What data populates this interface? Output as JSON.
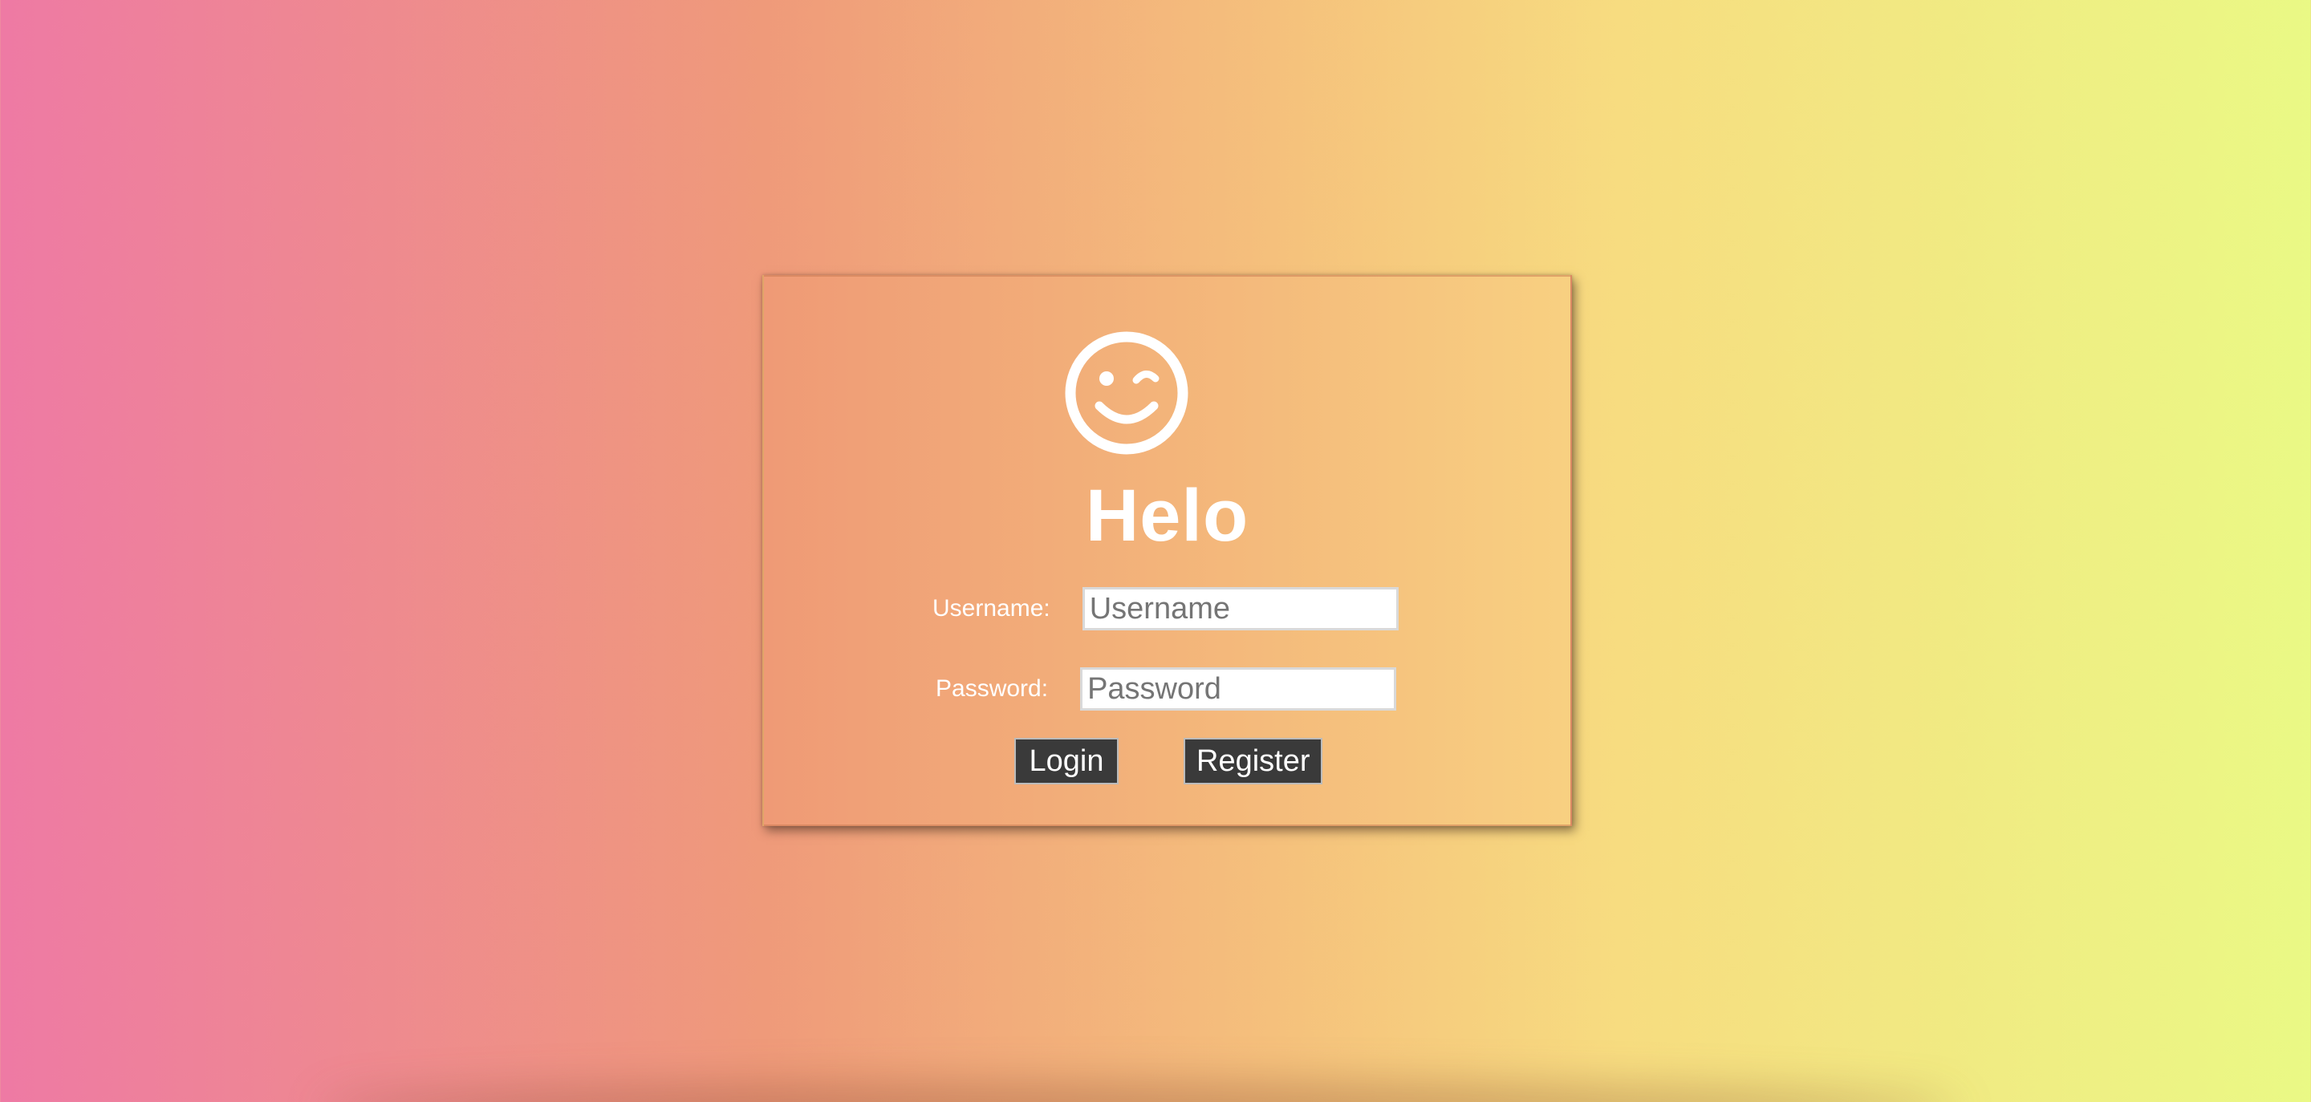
{
  "login": {
    "title": "Helo",
    "logo_icon": "wink-smiley-icon",
    "username_label": "Username:",
    "username_placeholder": "Username",
    "password_label": "Password:",
    "password_placeholder": "Password",
    "login_button": "Login",
    "register_button": "Register"
  },
  "colors": {
    "gradient_start": "#ee7aa4",
    "gradient_end": "#eaf985",
    "button_bg": "#3a3a3a",
    "text": "#ffffff"
  }
}
